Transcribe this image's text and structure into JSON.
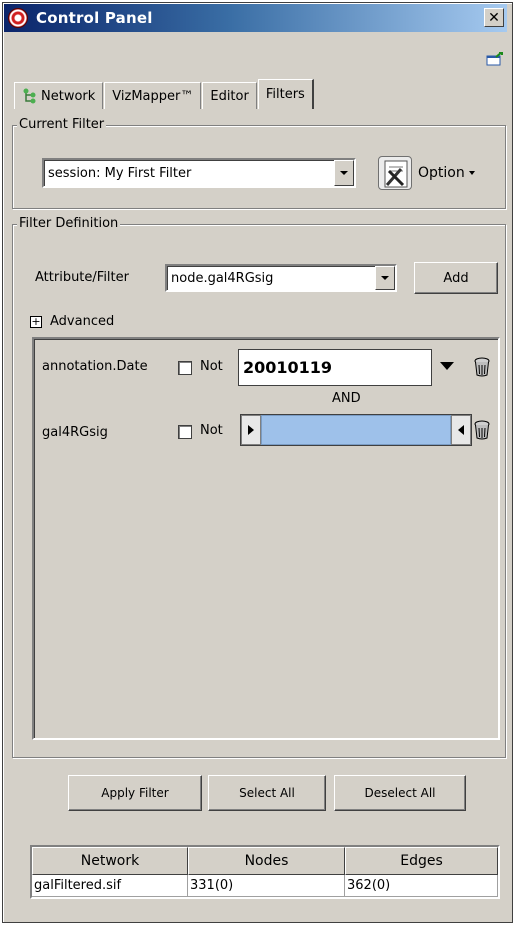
{
  "window": {
    "title": "Control Panel",
    "close_glyph": "✕"
  },
  "tabs": [
    {
      "label": "Network",
      "icon": "tree-network-icon"
    },
    {
      "label": "VizMapper™"
    },
    {
      "label": "Editor"
    },
    {
      "label": "Filters",
      "active": true
    }
  ],
  "current_filter": {
    "legend": "Current Filter",
    "selected": "session: My First Filter",
    "option_label": "Option"
  },
  "filter_definition": {
    "legend": "Filter Definition",
    "attribute_label": "Attribute/Filter",
    "attribute_selected": "node.gal4RGsig",
    "add_label": "Add",
    "advanced_label": "Advanced",
    "expander_glyph": "+"
  },
  "filters": [
    {
      "name": "annotation.Date",
      "not_label": "Not",
      "not_checked": false,
      "value": "20010119"
    },
    {
      "name": "gal4RGsig",
      "not_label": "Not",
      "not_checked": false
    }
  ],
  "operator_label": "AND",
  "actions": {
    "apply_label": "Apply Filter",
    "select_all_label": "Select All",
    "deselect_all_label": "Deselect All"
  },
  "table": {
    "headers": [
      "Network",
      "Nodes",
      "Edges"
    ],
    "rows": [
      [
        "galFiltered.sif",
        "331(0)",
        "362(0)"
      ]
    ]
  },
  "colors": {
    "title_gradient_start": "#0a246a",
    "panel_bg": "#d4d0c8",
    "slider_fill": "#9ec1ea"
  }
}
